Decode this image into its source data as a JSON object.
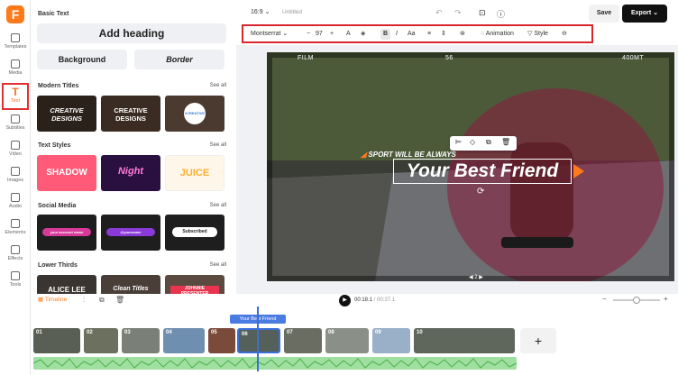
{
  "app": {
    "logo": "F"
  },
  "rail": [
    {
      "label": "Templates",
      "icon": "templates-icon"
    },
    {
      "label": "Media",
      "icon": "media-icon"
    },
    {
      "label": "Text",
      "icon": "text-icon",
      "active": true
    },
    {
      "label": "Subtitles",
      "icon": "subtitles-icon"
    },
    {
      "label": "Video",
      "icon": "video-icon"
    },
    {
      "label": "Images",
      "icon": "images-icon"
    },
    {
      "label": "Audio",
      "icon": "audio-icon"
    },
    {
      "label": "Elements",
      "icon": "elements-icon"
    },
    {
      "label": "Effects",
      "icon": "effects-icon"
    },
    {
      "label": "Tools",
      "icon": "tools-icon"
    }
  ],
  "panel": {
    "basic_text": "Basic Text",
    "add_heading": "Add heading",
    "background": "Background",
    "border": "Border",
    "modern_titles": "Modern Titles",
    "text_styles": "Text Styles",
    "social_media": "Social Media",
    "lower_thirds": "Lower Thirds",
    "see_all": "See all",
    "modern": [
      "CREATIVE DESIGNS",
      "CREATIVE DESIGNS",
      "#CREATIVE"
    ],
    "styles": [
      "SHADOW",
      "Night",
      "JUICE"
    ],
    "social": [
      "your account name",
      "@yourname",
      "Subscribed"
    ],
    "lower": [
      "ALICE LEE",
      "Clean Titles",
      "JOHNNIE PRESENTER"
    ]
  },
  "topbar": {
    "ratio": "16:9",
    "title": "Untitled",
    "save": "Save",
    "export": "Export"
  },
  "toolbar": {
    "font": "Montserrat",
    "size": "97",
    "minus": "−",
    "plus": "+",
    "animation": "Animation",
    "style": "Style"
  },
  "video": {
    "hud_left": "FILM",
    "hud_center": "56",
    "hud_right": "400MT",
    "sport": "SPORT WILL BE ALWAYS",
    "title": "Your Best Friend",
    "page": "2"
  },
  "playback": {
    "timeline": "Timeline",
    "time_current": "00:18.1",
    "time_total": "/ 00:37.1"
  },
  "tracks": {
    "text_clip": "Your Best Friend",
    "clip_numbers": [
      "01",
      "02",
      "03",
      "04",
      "05",
      "06",
      "07",
      "08",
      "09",
      "10"
    ]
  },
  "colors": {
    "accent": "#ff7a1a",
    "highlight": "#d9262c",
    "dark": "#111111",
    "audio": "#9fdf9f"
  }
}
